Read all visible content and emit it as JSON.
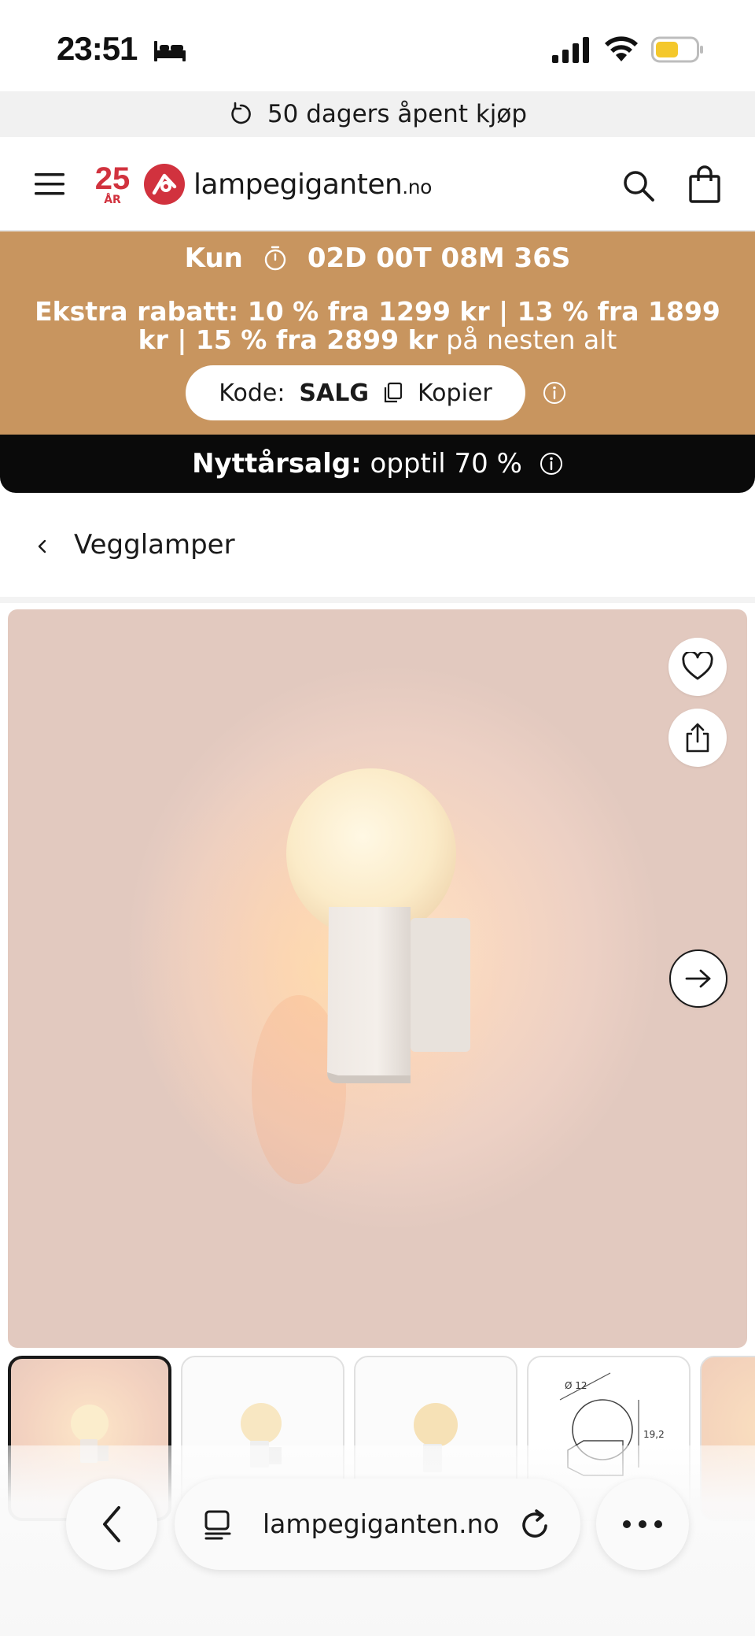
{
  "status_bar": {
    "time": "23:51"
  },
  "promo_strip": {
    "label": "50 dagers åpent kjøp"
  },
  "header": {
    "logo_anniversary": "25",
    "logo_anniversary_sub": "ÅR",
    "logo_name": "lampegiganten",
    "logo_tld": ".no"
  },
  "sale_banner": {
    "prefix": "Kun",
    "countdown": "02D 00T 08M 36S",
    "discount_bold": "Ekstra rabatt: 10 % fra 1299 kr | 13 % fra 1899 kr | 15 % fra 2899 kr",
    "discount_rest": " på nesten alt",
    "code_label": "Kode:",
    "code_value": "SALG",
    "copy_label": "Kopier"
  },
  "sale_bar": {
    "label_bold": "Nyttårsalg:",
    "label_rest": "opptil 70 %"
  },
  "breadcrumb": {
    "label": "Vegglamper"
  },
  "thumbnails": {
    "dimension_diameter": "Ø 12",
    "dimension_height": "19,2"
  },
  "browser": {
    "url": "lampegiganten.no"
  },
  "colors": {
    "brand_red": "#d1323e",
    "banner": "#c8955f",
    "sale_bar": "#0a0a0a"
  }
}
